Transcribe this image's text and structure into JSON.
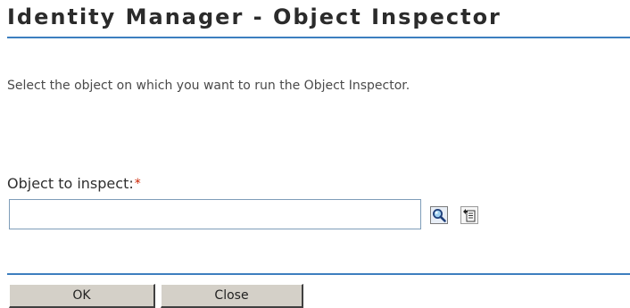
{
  "page": {
    "title": "Identity Manager - Object Inspector",
    "description": "Select the object on which you want to run the Object Inspector."
  },
  "form": {
    "object_label": "Object to inspect:",
    "required_marker": "*",
    "object_value": ""
  },
  "icons": {
    "search": "search-icon",
    "history": "history-list-icon"
  },
  "buttons": {
    "ok_label": "OK",
    "close_label": "Close"
  },
  "colors": {
    "rule": "#3d7fbf",
    "required": "#cc2200",
    "button_face": "#d4d0c8"
  }
}
